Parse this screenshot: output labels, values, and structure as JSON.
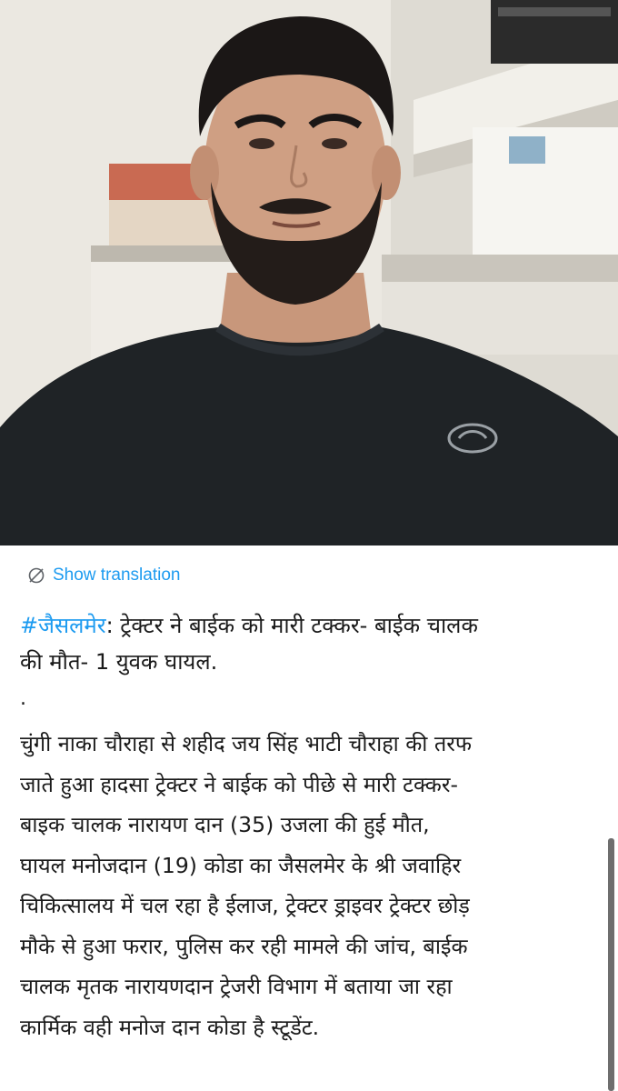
{
  "translation": {
    "label": "Show translation",
    "icon": "globe-slash-icon",
    "color": "#1d9bf0"
  },
  "post": {
    "hashtag": "#जैसलमेर",
    "headline_rest": ": ट्रेक्टर ने बाईक को मारी टक्कर- बाईक चालक",
    "headline_line2": "की मौत- 1 युवक घायल.",
    "separator": ".",
    "body_lines": [
      "चुंगी नाका चौराहा से शहीद जय सिंह भाटी चौराहा की तरफ",
      "जाते हुआ हादसा ट्रेक्टर ने बाईक को पीछे से मारी टक्कर-",
      "बाइक चालक  नारायण दान  (35) उजला की हुई मौत,",
      "घायल मनोजदान (19) कोडा का जैसलमेर के श्री जवाहिर",
      "चिकित्सालय में चल रहा है ईलाज, ट्रेक्टर ड्राइवर ट्रेक्टर छोड़",
      "मौके से हुआ फरार,  पुलिस कर रही मामले की जांच, बाईक",
      "चालक मृतक  नारायणदान ट्रेजरी विभाग में बताया जा रहा",
      "कार्मिक  वही  मनोज दान कोडा है स्टूडेंट."
    ],
    "trailing_dot": "."
  }
}
